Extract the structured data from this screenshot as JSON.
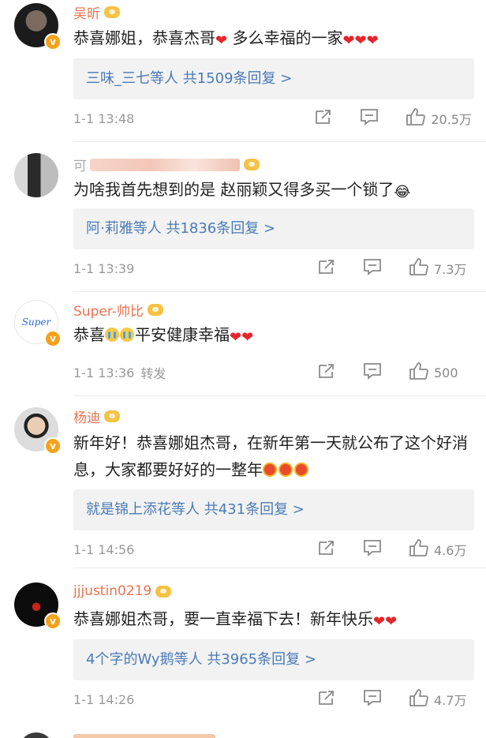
{
  "comments": [
    {
      "username": "吴昕",
      "text": "恭喜娜姐，恭喜杰哥",
      "text_tail": "多么幸福的一家",
      "replies": "三味_三七等人 共1509条回复 >",
      "time": "1-1 13:48",
      "likes": "20.5万"
    },
    {
      "username": "可",
      "text": "为啥我首先想到的是 赵丽颖又得多买一个锁了",
      "replies": "阿·莉雅等人 共1836条回复 >",
      "time": "1-1 13:39",
      "likes": "7.3万"
    },
    {
      "username": "Super-帅比",
      "avatar_text": "Super",
      "text_a": "恭喜",
      "text_b": "平安健康幸福",
      "time": "1-1 13:36",
      "forward": "转发",
      "likes": "500"
    },
    {
      "username": "杨迪",
      "text": "新年好！恭喜娜姐杰哥，在新年第一天就公布了这个好消息，大家都要好好的一整年",
      "replies": "就是锦上添花等人 共431条回复 >",
      "time": "1-1 14:56",
      "likes": "4.6万"
    },
    {
      "username": "jjjustin0219",
      "text": "恭喜娜姐杰哥，要一直幸福下去！新年快乐",
      "replies": "4个字的Wy鹅等人 共3965条回复 >",
      "time": "1-1 14:26",
      "likes": "4.7万"
    }
  ],
  "icons": {
    "share": "share-icon",
    "comment": "comment-icon",
    "like": "like-icon"
  },
  "colors": {
    "username": "#eb7350",
    "link": "#4a7bb7",
    "badge": "#f4a21b"
  }
}
